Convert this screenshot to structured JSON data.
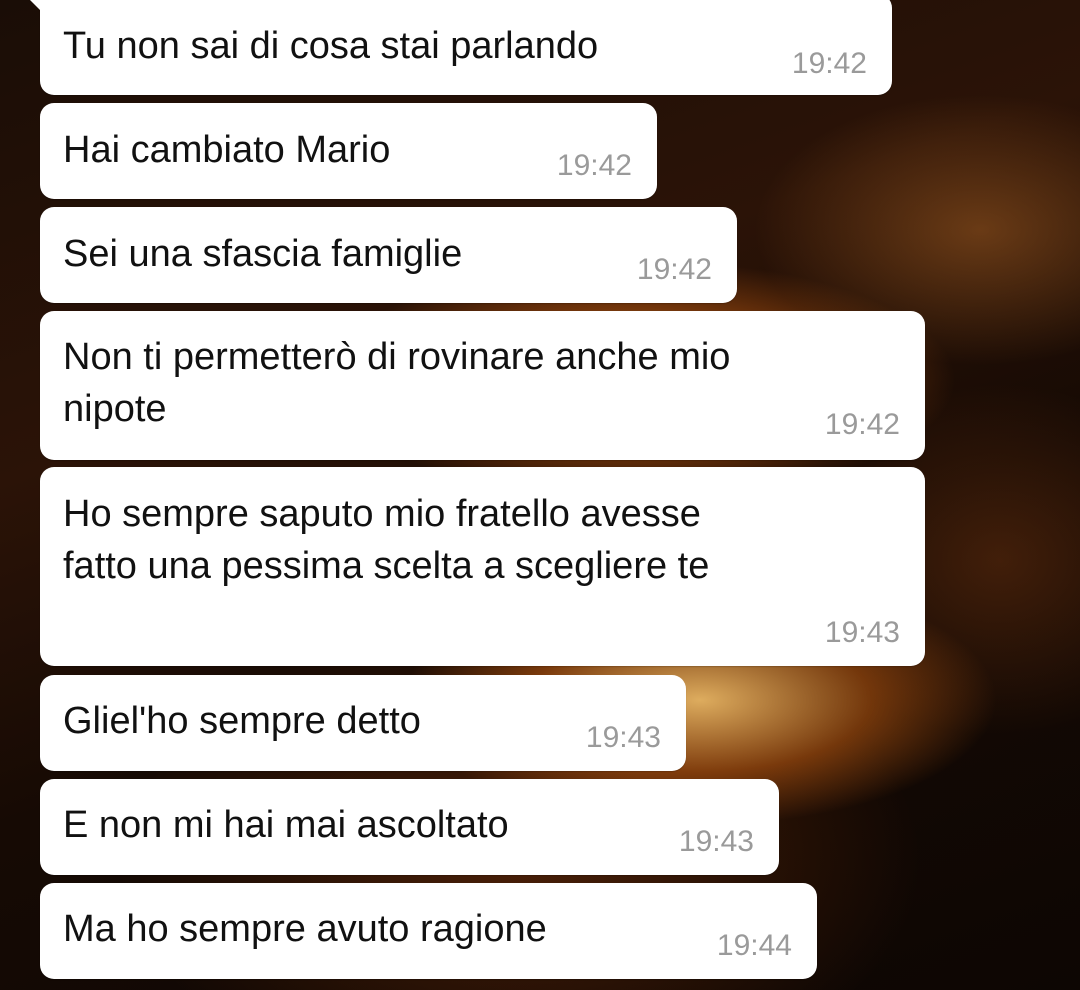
{
  "conversation": {
    "messages": [
      {
        "text": "Tu non sai di cosa stai parlando",
        "time": "19:42"
      },
      {
        "text": "Hai cambiato Mario",
        "time": "19:42"
      },
      {
        "text": "Sei una sfascia famiglie",
        "time": "19:42"
      },
      {
        "text_line1": "Non ti permetterò di rovinare anche mio",
        "text_line2": "nipote",
        "time": "19:42"
      },
      {
        "text_line1": "Ho sempre saputo mio fratello avesse",
        "text_line2": "fatto una pessima scelta a scegliere te",
        "time": "19:43"
      },
      {
        "text": "Gliel'ho sempre detto",
        "time": "19:43"
      },
      {
        "text": "E non mi hai mai ascoltato",
        "time": "19:43"
      },
      {
        "text": "Ma ho sempre avuto ragione",
        "time": "19:44"
      }
    ]
  },
  "colors": {
    "bubble_background": "#ffffff",
    "message_text": "#111111",
    "timestamp_text": "#9a9a9a"
  }
}
